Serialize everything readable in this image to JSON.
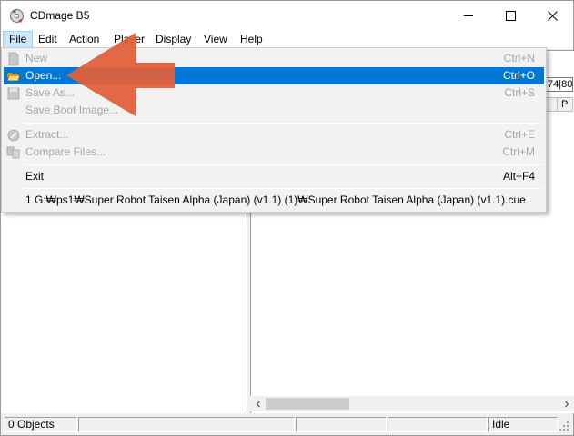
{
  "window": {
    "title": "CDmage B5",
    "icon": "cdmage-app-icon",
    "controls": [
      "minimize-icon",
      "maximize-icon",
      "close-icon"
    ]
  },
  "menubar": {
    "items": [
      {
        "label": "File",
        "active": true
      },
      {
        "label": "Edit"
      },
      {
        "label": "Action"
      },
      {
        "label": "Player"
      },
      {
        "label": "Display"
      },
      {
        "label": "View"
      },
      {
        "label": "Help"
      }
    ]
  },
  "file_menu": {
    "new": {
      "label": "New",
      "shortcut": "Ctrl+N",
      "icon": "new-file-icon",
      "enabled": false
    },
    "open": {
      "label": "Open...",
      "shortcut": "Ctrl+O",
      "icon": "open-folder-icon",
      "enabled": true,
      "highlighted": true
    },
    "save_as": {
      "label": "Save As...",
      "shortcut": "Ctrl+S",
      "icon": "save-icon",
      "enabled": false
    },
    "save_boot_image": {
      "label": "Save Boot Image...",
      "shortcut": "",
      "enabled": false
    },
    "extract": {
      "label": "Extract...",
      "shortcut": "Ctrl+E",
      "icon": "extract-icon",
      "enabled": false
    },
    "compare_files": {
      "label": "Compare Files...",
      "shortcut": "Ctrl+M",
      "icon": "compare-icon",
      "enabled": false
    },
    "exit": {
      "label": "Exit",
      "shortcut": "Alt+F4",
      "enabled": true
    },
    "recent_1": {
      "label": "1 G:₩ps1₩Super Robot Taisen Alpha (Japan) (v1.1) (1)₩Super Robot Taisen Alpha (Japan) (v1.1).cue",
      "enabled": true
    }
  },
  "right_pane": {
    "toolbar_fragment": "74|80",
    "header_fragment": "P"
  },
  "statusbar": {
    "objects": "0 Objects",
    "state": "Idle"
  },
  "annotation": {
    "type": "arrow",
    "color": "#e0603c",
    "points_to": "open-menu-item"
  },
  "colors": {
    "highlight": "#0078d7",
    "menu_active_bg": "#cce8ff",
    "disabled_text": "#a6a6a6"
  }
}
